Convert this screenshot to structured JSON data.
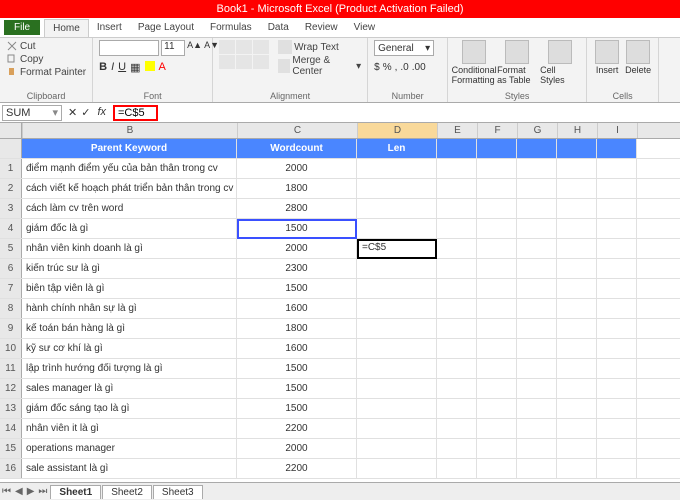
{
  "title": "Book1 - Microsoft Excel (Product Activation Failed)",
  "tabs": {
    "file": "File",
    "list": [
      "Home",
      "Insert",
      "Page Layout",
      "Formulas",
      "Data",
      "Review",
      "View"
    ],
    "active": "Home"
  },
  "ribbon": {
    "clipboard": {
      "label": "Clipboard",
      "cut": "Cut",
      "copy": "Copy",
      "fmt": "Format Painter"
    },
    "font": {
      "label": "Font",
      "size": "11"
    },
    "alignment": {
      "label": "Alignment",
      "wrap": "Wrap Text",
      "merge": "Merge & Center"
    },
    "number": {
      "label": "Number",
      "format": "General"
    },
    "styles": {
      "label": "Styles",
      "cond": "Conditional Formatting",
      "fmt": "Format as Table",
      "cell": "Cell Styles"
    },
    "cells": {
      "label": "Cells",
      "ins": "Insert",
      "del": "Delete"
    }
  },
  "namebox": "SUM",
  "formula": "=C$5",
  "columns": [
    "A",
    "B",
    "C",
    "D",
    "E",
    "F",
    "G",
    "H",
    "I"
  ],
  "header": {
    "b": "Parent Keyword",
    "c": "Wordcount",
    "d": "Len"
  },
  "rows": [
    {
      "n": 1,
      "b": "điểm mạnh điểm yếu của bản thân trong cv",
      "c": "2000"
    },
    {
      "n": 2,
      "b": "cách viết kế hoạch phát triển bản thân trong cv",
      "c": "1800"
    },
    {
      "n": 3,
      "b": "cách làm cv trên word",
      "c": "2800"
    },
    {
      "n": 4,
      "b": "giám đốc là gì",
      "c": "1500"
    },
    {
      "n": 5,
      "b": "nhân viên kinh doanh là gì",
      "c": "2000"
    },
    {
      "n": 6,
      "b": "kiến trúc sư là gì",
      "c": "2300"
    },
    {
      "n": 7,
      "b": "biên tập viên là gì",
      "c": "1500"
    },
    {
      "n": 8,
      "b": "hành chính nhân sự là gì",
      "c": "1600"
    },
    {
      "n": 9,
      "b": "kế toán bán hàng là gì",
      "c": "1800"
    },
    {
      "n": 10,
      "b": "kỹ sư cơ khí là gì",
      "c": "1600"
    },
    {
      "n": 11,
      "b": "lập trình hướng đối tượng là gì",
      "c": "1500"
    },
    {
      "n": 12,
      "b": "sales manager là gì",
      "c": "1500"
    },
    {
      "n": 13,
      "b": "giám đốc sáng tạo là gì",
      "c": "1500"
    },
    {
      "n": 14,
      "b": "nhân viên it là gì",
      "c": "2200"
    },
    {
      "n": 15,
      "b": "operations manager",
      "c": "2000"
    },
    {
      "n": 16,
      "b": "sale assistant là gì",
      "c": "2200"
    }
  ],
  "editing_cell": "=C$5",
  "sheets": [
    "Sheet1",
    "Sheet2",
    "Sheet3"
  ]
}
